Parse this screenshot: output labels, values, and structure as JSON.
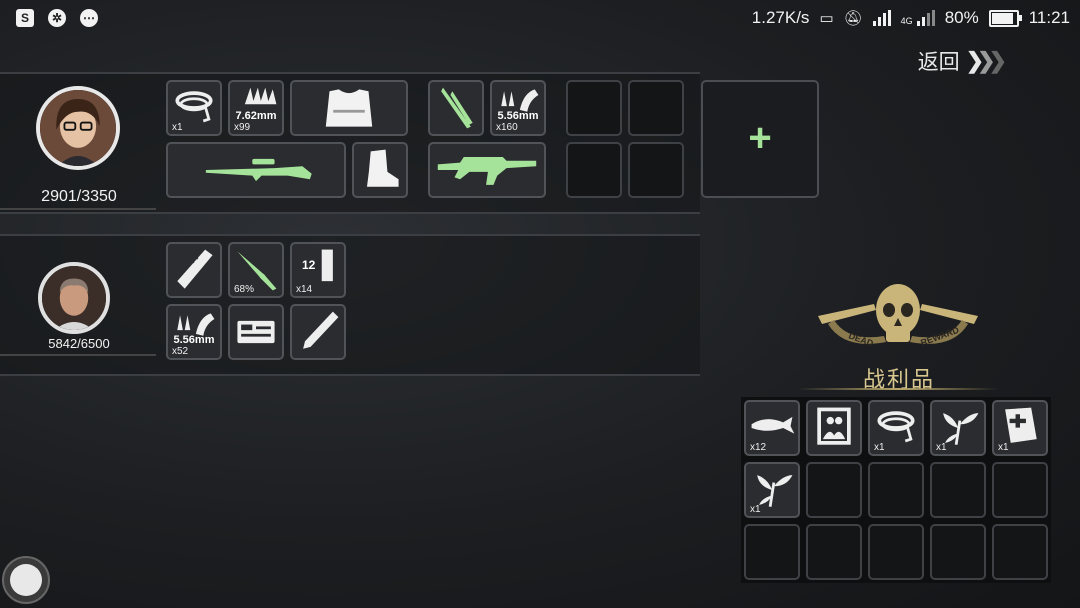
{
  "status_bar": {
    "speed": "1.27K/s",
    "network": "4G",
    "battery": "80%",
    "battery_level": 0.8,
    "time": "11:21",
    "left_icons": [
      "app-s-icon",
      "aperture-icon",
      "more-icon"
    ]
  },
  "back": {
    "label": "返回"
  },
  "members": [
    {
      "hp": "2901/3350",
      "hp_fraction": 0.866,
      "slots": [
        {
          "icon": "rope-icon",
          "count": "x1"
        },
        {
          "icon": "ammo-762-icon",
          "caliber": "7.62mm",
          "count": "x99"
        },
        {
          "icon": "body-armor-icon"
        },
        {
          "icon": "crossed-knives-icon"
        },
        {
          "icon": "ammo-556-icon",
          "caliber": "5.56mm",
          "count": "x160"
        },
        {
          "icon": "sniper-rifle-icon"
        },
        {
          "icon": "boot-icon"
        },
        {
          "icon": "machine-gun-icon"
        }
      ]
    },
    {
      "hp": "5842/6500",
      "hp_fraction": 0.899,
      "slots": [
        {
          "icon": "comb-icon"
        },
        {
          "icon": "knife-icon",
          "count": "68%"
        },
        {
          "icon": "battery-cell-icon",
          "label": "12",
          "count": "x14"
        },
        {
          "icon": "ammo-556-icon",
          "caliber": "5.56mm",
          "count": "x52"
        },
        {
          "icon": "id-card-icon"
        },
        {
          "icon": "pen-icon"
        }
      ]
    }
  ],
  "add_member": {
    "symbol": "+"
  },
  "loot": {
    "emblem_text": [
      "DEAD",
      "REWARD"
    ],
    "title": "战利品",
    "items": [
      {
        "icon": "fish-icon",
        "count": "x12"
      },
      {
        "icon": "photo-icon",
        "count": ""
      },
      {
        "icon": "rope-icon",
        "count": "x1"
      },
      {
        "icon": "herb-icon",
        "count": "x1"
      },
      {
        "icon": "medkit-book-icon",
        "count": "x1"
      },
      {
        "icon": "herb-icon",
        "count": "x1"
      }
    ]
  },
  "colors": {
    "accent_green": "#a6e39a",
    "gold": "#c9b57a"
  }
}
